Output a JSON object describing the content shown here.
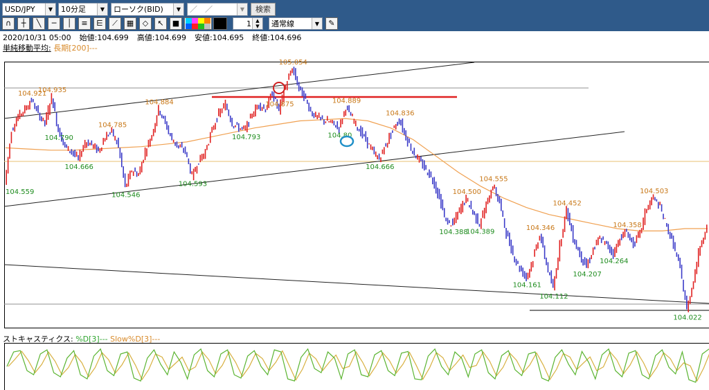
{
  "toolbar": {
    "symbol": "USD/JPY",
    "timeframe": "10分足",
    "chart_type": "ローソク(BID)",
    "date": "／　／",
    "search_label": "検索",
    "line_width": "1",
    "line_style": "通常線"
  },
  "info": {
    "datetime": "2020/10/31 05:00",
    "open": "始値:104.699",
    "high": "高値:104.699",
    "low": "安値:104.695",
    "close": "終値:104.696"
  },
  "ma_legend": {
    "label": "単純移動平均:",
    "series": "長期[200]---"
  },
  "stoch_legend": {
    "label": "ストキャスティクス:",
    "k": "%D[3]---",
    "d": "Slow%D[3]---"
  },
  "colors": {
    "bull": "#e02020",
    "bear": "#3a3ac8",
    "ma": "#f0a050",
    "high_label": "#c87818",
    "low_label": "#1e8c1e",
    "stoch_k": "#5ab430",
    "stoch_d": "#d8b040"
  },
  "chart_data": {
    "type": "line",
    "symbol": "USD/JPY",
    "series": [
      {
        "values": [
          104.56,
          104.79,
          104.85,
          104.88,
          104.92,
          104.86,
          104.82,
          104.935,
          104.79,
          104.72,
          104.7,
          104.666,
          104.74,
          104.73,
          104.7,
          104.76,
          104.785,
          104.72,
          104.546,
          104.62,
          104.6,
          104.7,
          104.77,
          104.884,
          104.82,
          104.75,
          104.72,
          104.7,
          104.593,
          104.66,
          104.7,
          104.79,
          104.86,
          104.9,
          104.82,
          104.8,
          104.793,
          104.86,
          104.9,
          104.88,
          104.95,
          104.875,
          104.98,
          105.054,
          104.97,
          104.92,
          104.86,
          104.84,
          104.83,
          104.82,
          104.8,
          104.889,
          104.84,
          104.79,
          104.75,
          104.7,
          104.666,
          104.73,
          104.79,
          104.836,
          104.76,
          104.7,
          104.66,
          104.62,
          104.58,
          104.5,
          104.4,
          104.388,
          104.45,
          104.5,
          104.44,
          104.389,
          104.47,
          104.555,
          104.48,
          104.35,
          104.26,
          104.2,
          104.161,
          104.24,
          104.346,
          104.22,
          104.112,
          104.3,
          104.452,
          104.33,
          104.26,
          104.207,
          104.28,
          104.33,
          104.3,
          104.264,
          104.33,
          104.358,
          104.3,
          104.35,
          104.46,
          104.503,
          104.46,
          104.38,
          104.3,
          104.2,
          104.022,
          104.15,
          104.3,
          104.38
        ]
      },
      {
        "name": "長期[200]",
        "values": [
          104.715,
          104.71,
          104.705,
          104.705,
          104.71,
          104.715,
          104.72,
          104.73,
          104.74,
          104.76,
          104.78,
          104.8,
          104.815,
          104.83,
          104.835,
          104.84,
          104.83,
          104.8,
          104.75,
          104.68,
          104.61,
          104.55,
          104.5,
          104.46,
          104.43,
          104.41,
          104.39,
          104.37,
          104.36,
          104.36,
          104.37,
          104.37
        ]
      }
    ],
    "ylim": [
      103.95,
      105.08
    ],
    "annotations": {
      "highs": [
        {
          "i": 4,
          "label": "104.921"
        },
        {
          "i": 7,
          "label": "104.935"
        },
        {
          "i": 16,
          "label": "104.785"
        },
        {
          "i": 23,
          "label": "104.884"
        },
        {
          "i": 41,
          "label": "104.875"
        },
        {
          "i": 43,
          "label": "105.054"
        },
        {
          "i": 51,
          "label": "104.889"
        },
        {
          "i": 59,
          "label": "104.836"
        },
        {
          "i": 73,
          "label": "104.555"
        },
        {
          "i": 69,
          "label": "104.500"
        },
        {
          "i": 80,
          "label": "104.346"
        },
        {
          "i": 84,
          "label": "104.452"
        },
        {
          "i": 93,
          "label": "104.358"
        },
        {
          "i": 97,
          "label": "104.503"
        }
      ],
      "lows": [
        {
          "i": 0,
          "label": "104.559"
        },
        {
          "i": 8,
          "label": "104.790"
        },
        {
          "i": 11,
          "label": "104.666"
        },
        {
          "i": 18,
          "label": "104.546"
        },
        {
          "i": 28,
          "label": "104.593"
        },
        {
          "i": 36,
          "label": "104.793"
        },
        {
          "i": 50,
          "label": "104.80"
        },
        {
          "i": 56,
          "label": "104.666"
        },
        {
          "i": 67,
          "label": "104.388"
        },
        {
          "i": 71,
          "label": "104.389"
        },
        {
          "i": 78,
          "label": "104.161"
        },
        {
          "i": 82,
          "label": "104.112"
        },
        {
          "i": 87,
          "label": "104.207"
        },
        {
          "i": 91,
          "label": "104.264"
        },
        {
          "i": 102,
          "label": "104.022"
        }
      ]
    },
    "stochastic": {
      "k": [
        50,
        85,
        88,
        40,
        30,
        80,
        90,
        35,
        25,
        70,
        88,
        30,
        20,
        75,
        92,
        40,
        28,
        80,
        85,
        22,
        15,
        70,
        90,
        55,
        30,
        85,
        60,
        20,
        78,
        92,
        40,
        25,
        80,
        90,
        30,
        22,
        75,
        88,
        50,
        30,
        90,
        85,
        20,
        15,
        72,
        92,
        45,
        35,
        85,
        70,
        20,
        80,
        90,
        30,
        25,
        78,
        88,
        40,
        28,
        82,
        86,
        20,
        18,
        75,
        92,
        50,
        30,
        85,
        70,
        25,
        80,
        90,
        35,
        20,
        76,
        88,
        42,
        28,
        80,
        85,
        22,
        15,
        72,
        90,
        55,
        30,
        86,
        60,
        20,
        78,
        92,
        40,
        25,
        82,
        88,
        30,
        20,
        76,
        90,
        48,
        32,
        85,
        18,
        12,
        80,
        92
      ]
    }
  }
}
